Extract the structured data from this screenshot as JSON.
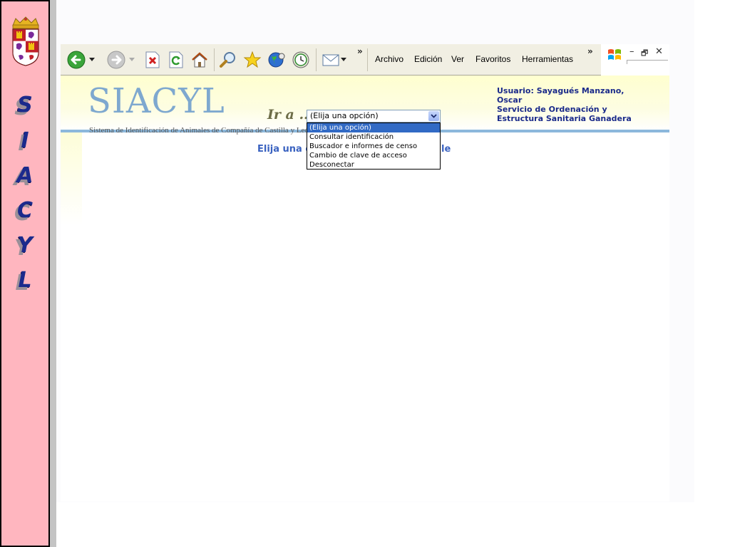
{
  "banner": {
    "letters": [
      "S",
      "I",
      "A",
      "C",
      "Y",
      "L"
    ],
    "background_color": "#ffb6bf",
    "letter_color": "#1b2a8c",
    "crest_icon": "castilla-y-leon-coat-of-arms-icon"
  },
  "browser": {
    "toolbar": {
      "icons": [
        "back-arrow-icon",
        "forward-arrow-icon",
        "stop-icon",
        "refresh-icon",
        "home-icon",
        "search-icon",
        "favorites-star-icon",
        "media-globe-icon",
        "history-icon",
        "mail-icon"
      ],
      "overflow_chevron": "»",
      "menus": [
        "Archivo",
        "Edición",
        "Ver",
        "Favoritos",
        "Herramientas"
      ],
      "menu_overflow_chevron": "»",
      "window_controls": {
        "minimize": "–",
        "restore": "🗗",
        "close": "✕"
      }
    },
    "page": {
      "logo": "SIACYL",
      "subtitle": "Sistema de Identificación de Animales de Compañía de Castilla y León",
      "goto_label": "Ir a ...",
      "select": {
        "value": "(Elija una opción)",
        "options": [
          "(Elija una opción)",
          "Consultar identificación",
          "Buscador e informes de censo",
          "Cambio de clave de acceso",
          "Desconectar"
        ],
        "selected_index": 0
      },
      "user": {
        "line1": "Usuario: Sayagués Manzano,",
        "line2": "Oscar",
        "line3": "Servicio de Ordenación y",
        "line4": "Estructura Sanitaria Ganadera"
      },
      "message_left": "Elija una o",
      "message_right": "le",
      "colors": {
        "header_line": "#8cb8dc",
        "logo": "#7ea8cf",
        "user_text": "#1a2a8a",
        "message": "#3a62c0",
        "selected_option": "#316ac5"
      }
    }
  }
}
